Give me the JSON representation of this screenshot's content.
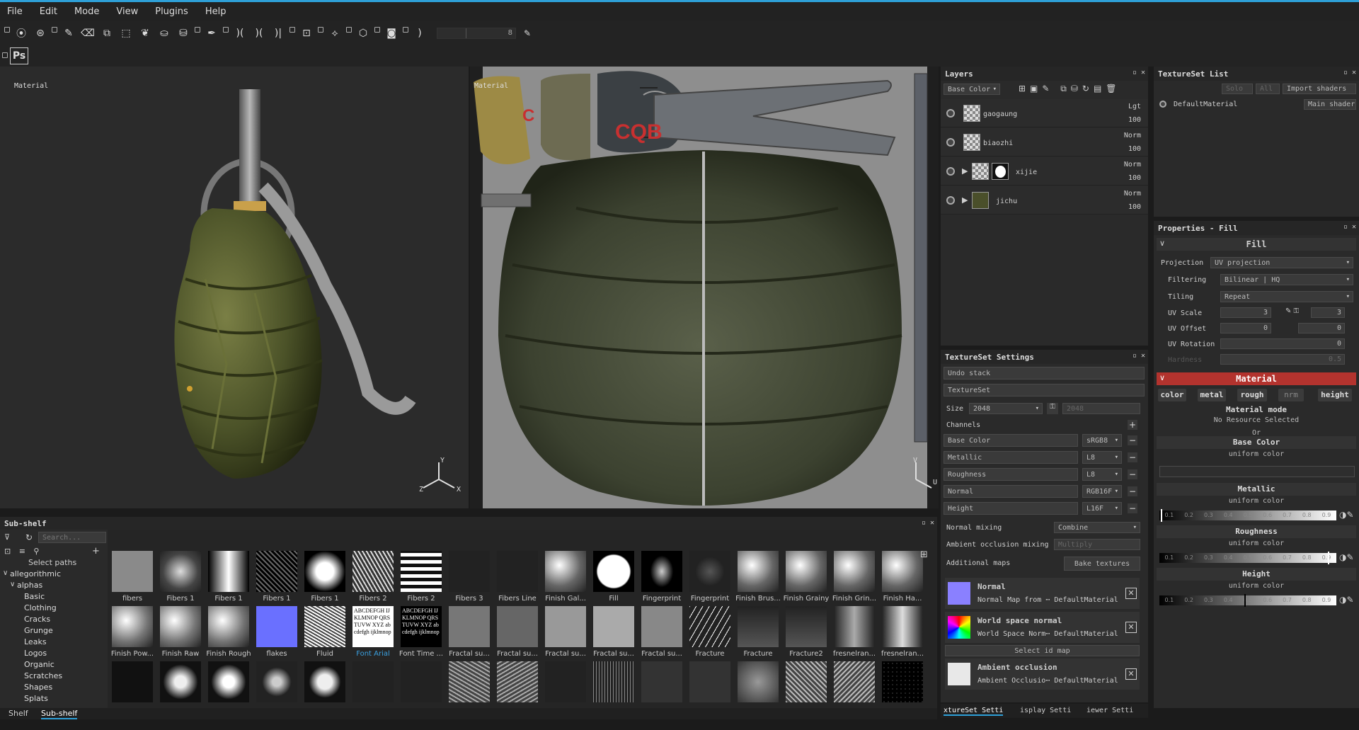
{
  "menu": [
    "File",
    "Edit",
    "Mode",
    "View",
    "Plugins",
    "Help"
  ],
  "toolbar": {
    "brush_size": "8",
    "ps_label": "Ps"
  },
  "viewport3d": {
    "label": "Material",
    "gizmo": {
      "y": "Y",
      "x": "X",
      "z": "Z"
    }
  },
  "viewport2d": {
    "label": "Material",
    "gizmo": {
      "v": "V",
      "u": "U"
    },
    "uv_text": "CQB",
    "uv_text2": "C"
  },
  "layers": {
    "title": "Layers",
    "channel": "Base Color",
    "items": [
      {
        "name": "gaogaung",
        "blend": "Lgt",
        "opacity": "100"
      },
      {
        "name": "biaozhi",
        "blend": "Norm",
        "opacity": "100"
      },
      {
        "name": "xijie",
        "blend": "Norm",
        "opacity": "100"
      },
      {
        "name": "jichu",
        "blend": "Norm",
        "opacity": "100"
      }
    ]
  },
  "textureset_list": {
    "title": "TextureSet List",
    "solo": "Solo",
    "all": "All",
    "import": "Import shaders",
    "material": "DefaultMaterial",
    "shader": "Main shader"
  },
  "textureset_settings": {
    "title": "TextureSet Settings",
    "undo": "Undo stack",
    "textureset": "TextureSet",
    "size_label": "Size",
    "size": "2048",
    "size2": "2048",
    "channels_label": "Channels",
    "channels": [
      {
        "name": "Base Color",
        "fmt": "sRGB8"
      },
      {
        "name": "Metallic",
        "fmt": "L8"
      },
      {
        "name": "Roughness",
        "fmt": "L8"
      },
      {
        "name": "Normal",
        "fmt": "RGB16F"
      },
      {
        "name": "Height",
        "fmt": "L16F"
      }
    ],
    "normal_mixing_label": "Normal mixing",
    "normal_mixing": "Combine",
    "ao_mixing_label": "Ambient occlusion mixing",
    "ao_mixing": "Multiply",
    "additional_maps": "Additional maps",
    "bake": "Bake textures",
    "maps": [
      {
        "title": "Normal",
        "sub": "Normal Map from ⋯ DefaultMaterial"
      },
      {
        "title": "World space normal",
        "sub": "World Space Norm⋯ DefaultMaterial"
      },
      {
        "title": "Ambient occlusion",
        "sub": "Ambient Occlusio⋯ DefaultMaterial"
      }
    ],
    "select_id": "Select id map"
  },
  "properties": {
    "title": "Properties - Fill",
    "fill": "Fill",
    "projection_label": "Projection",
    "projection": "UV projection",
    "filtering_label": "Filtering",
    "filtering": "Bilinear | HQ",
    "tiling_label": "Tiling",
    "tiling": "Repeat",
    "uvscale_label": "UV Scale",
    "uvscale": "3",
    "uvscale2": "3",
    "uvoffset_label": "UV Offset",
    "uvoffset": "0",
    "uvoffset2": "0",
    "uvrot_label": "UV Rotation",
    "uvrot": "0",
    "hardness_label": "Hardness",
    "hardness": "0.5",
    "material": "Material",
    "tabs": [
      "color",
      "metal",
      "rough",
      "nrm",
      "height"
    ],
    "mode_label": "Material mode",
    "mode": "No Resource Selected",
    "or": "Or",
    "base_color": "Base Color",
    "metallic": "Metallic",
    "roughness": "Roughness",
    "height": "Height",
    "uniform": "uniform color",
    "ticks": [
      "0.1",
      "0.2",
      "0.3",
      "0.4",
      "0.5",
      "0.6",
      "0.7",
      "0.8",
      "0.9"
    ]
  },
  "bottom_tabs": [
    "xtureSet Setti",
    "isplay Setti",
    "iewer Setti"
  ],
  "shelf": {
    "title": "Sub-shelf",
    "search": "Search...",
    "select_paths": "Select paths",
    "tabs": [
      "Shelf",
      "Sub-shelf"
    ],
    "tree": [
      "allegorithmic",
      "alphas",
      "Basic",
      "Clothing",
      "Cracks",
      "Grunge",
      "Leaks",
      "Logos",
      "Organic",
      "Scratches",
      "Shapes",
      "Splats"
    ],
    "row1": [
      "fibers",
      "Fibers 1",
      "Fibers 1",
      "Fibers 1",
      "Fibers 1",
      "Fibers 2",
      "Fibers 2",
      "Fibers 3",
      "Fibers Line",
      "Finish Gal...",
      "Fill",
      "Fingerprint",
      "Fingerprint",
      "Finish Brus...",
      "Finish Grainy",
      "Finish Grin...",
      "Finish Ha..."
    ],
    "row2": [
      "Finish Pow...",
      "Finish Raw",
      "Finish Rough",
      "flakes",
      "Fluid",
      "Font Arial",
      "Font Time ...",
      "Fractal su...",
      "Fractal su...",
      "Fractal su...",
      "Fractal su...",
      "Fractal su...",
      "Fracture",
      "Fracture",
      "Fracture2",
      "fresnelran...",
      "fresnelran..."
    ],
    "font_sample": "ABCDEFGH IJKLMNOP QRSTUVW XYZ abcdefgh ijklmnop"
  }
}
